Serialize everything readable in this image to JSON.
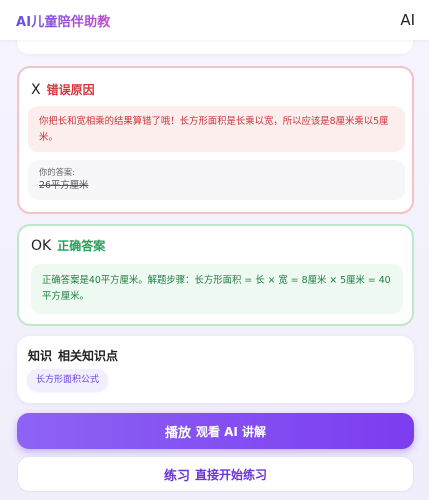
{
  "header": {
    "app_title": "AI儿童陪伴助教",
    "right_label": "AI"
  },
  "error_card": {
    "icon": "X",
    "title": "错误原因",
    "explanation": "你把长和宽相乘的结果算错了哦！长方形面积是长乘以宽，所以应该是8厘米乘以5厘米。",
    "answer_label": "你的答案:",
    "answer_value": "26平方厘米"
  },
  "correct_card": {
    "icon": "OK",
    "title": "正确答案",
    "explanation": "正确答案是40平方厘米。解题步骤：长方形面积 = 长 × 宽 = 8厘米 × 5厘米 = 40平方厘米。"
  },
  "knowledge_card": {
    "icon": "知识",
    "title": "相关知识点",
    "tags": [
      "长方形面积公式"
    ]
  },
  "actions": {
    "play": {
      "icon": "播放",
      "label": "观看 AI 讲解"
    },
    "practice": {
      "icon": "练习",
      "label": "直接开始练习"
    }
  },
  "colors": {
    "accent": "#7b3df0",
    "error": "#d9343a",
    "success": "#25a05b"
  }
}
